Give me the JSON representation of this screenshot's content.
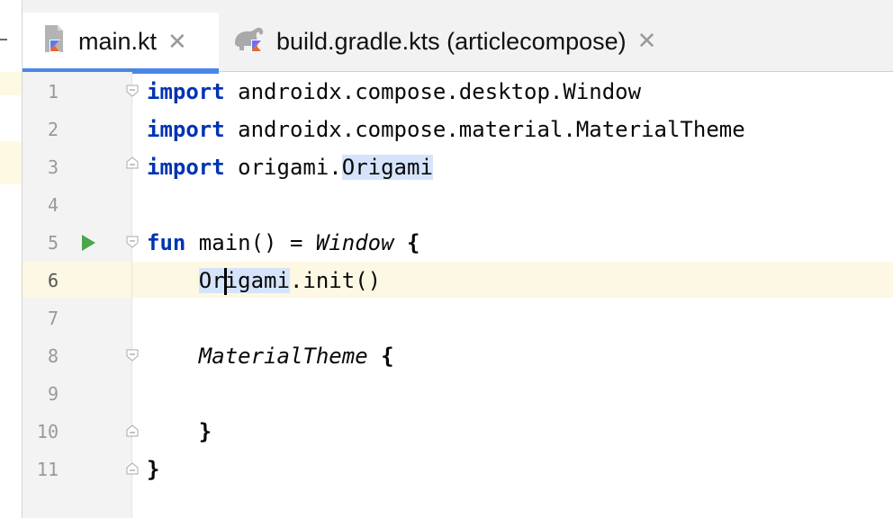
{
  "tabs": [
    {
      "label": "main.kt",
      "icon": "kotlin-file-icon",
      "active": true
    },
    {
      "label": "build.gradle.kts (articlecompose)",
      "icon": "gradle-kotlin-icon",
      "active": false
    }
  ],
  "editor": {
    "line_numbers": [
      "1",
      "2",
      "3",
      "4",
      "5",
      "6",
      "7",
      "8",
      "9",
      "10",
      "11"
    ],
    "current_line": 6,
    "lines": {
      "l1": {
        "kw": "import",
        "rest": " androidx.compose.desktop.Window"
      },
      "l2": {
        "kw": "import",
        "rest": " androidx.compose.material.MaterialTheme"
      },
      "l3": {
        "kw": "import",
        "pre": " origami.",
        "hl": "Origami"
      },
      "l5": {
        "kw": "fun",
        "mid": " main() = ",
        "it": "Window",
        "brace": " {"
      },
      "l6": {
        "indent": "    ",
        "hl_a": "Or",
        "hl_b": "igami",
        "rest": ".init()"
      },
      "l8": {
        "indent": "    ",
        "it": "MaterialTheme",
        "brace": " {"
      },
      "l10": {
        "indent": "    ",
        "brace": "}"
      },
      "l11": {
        "brace": "}"
      }
    }
  },
  "colors": {
    "keyword": "#0033b3",
    "run_icon": "#4aa64a",
    "tab_underline": "#4a86e8",
    "current_line": "#fdf8e3"
  }
}
